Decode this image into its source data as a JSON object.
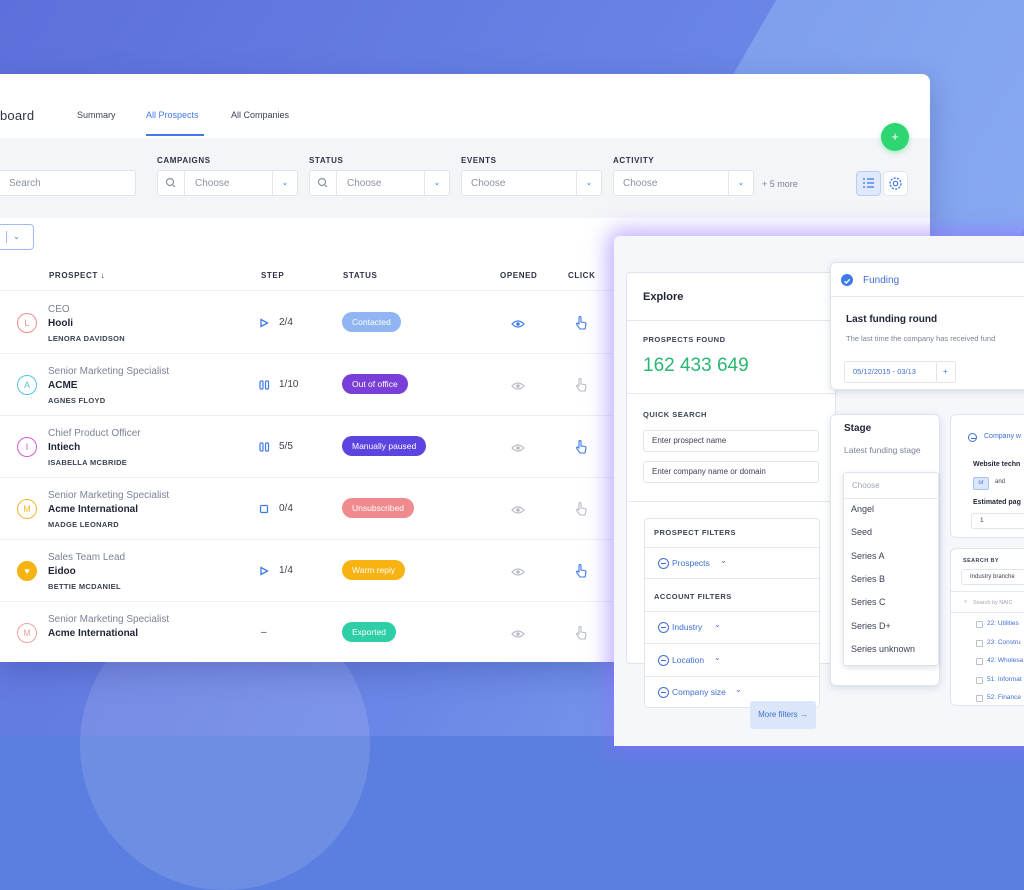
{
  "colors": {
    "accent": "#3f7be8",
    "green": "#2ed573",
    "found": "#2bb673"
  },
  "header": {
    "brand": "board",
    "tabs": [
      "Summary",
      "All Prospects",
      "All Companies"
    ],
    "add_label": "+"
  },
  "filters": {
    "search_placeholder": "Search",
    "campaigns_label": "CAMPAIGNS",
    "status_label": "STATUS",
    "events_label": "EVENTS",
    "activity_label": "ACTIVITY",
    "choose": "Choose",
    "more": "+ 5 more"
  },
  "table": {
    "headers": {
      "prospect": "PROSPECT ↓",
      "step": "STEP",
      "status": "STATUS",
      "opened": "OPENED",
      "click": "CLICK"
    },
    "rows": [
      {
        "initial": "L",
        "title": "CEO",
        "company": "Hooli",
        "name": "LENORA DAVIDSON",
        "step_icon": "play-icon",
        "step": "2/4",
        "status": "Contacted",
        "status_color": "#8fb5f3",
        "avatar_color": "#f08b8b",
        "opened": true,
        "clicked": true
      },
      {
        "initial": "A",
        "title": "Senior Marketing Specialist",
        "company": "ACME",
        "name": "AGNES FLOYD",
        "step_icon": "pause-icon",
        "step": "1/10",
        "status": "Out of office",
        "status_color": "#7a3fd6",
        "avatar_color": "#4fc7e0",
        "opened": false,
        "clicked": false
      },
      {
        "initial": "I",
        "title": "Chief Product Officer",
        "company": "Intiech",
        "name": "ISABELLA MCBRIDE",
        "step_icon": "pause-icon",
        "step": "5/5",
        "status": "Manually paused",
        "status_color": "#5b45e0",
        "avatar_color": "#d65bd6",
        "opened": false,
        "clicked": true
      },
      {
        "initial": "M",
        "title": "Senior Marketing Specialist",
        "company": "Acme International",
        "name": "MADGE LEONARD",
        "step_icon": "stop-icon",
        "step": "0/4",
        "status": "Unsubscribed",
        "status_color": "#f08a8e",
        "avatar_color": "#f2b731",
        "opened": false,
        "clicked": false
      },
      {
        "initial": "♥",
        "title": "Sales Team Lead",
        "company": "Eidoo",
        "name": "BETTIE MCDANIEL",
        "step_icon": "play-icon",
        "step": "1/4",
        "status": "Warm reply",
        "status_color": "#f7b312",
        "avatar_color": "#f7b312",
        "opened": false,
        "clicked": true
      },
      {
        "initial": "M",
        "title": "Senior Marketing Specialist",
        "company": "Acme International",
        "name": "",
        "step_icon": "",
        "step": "–",
        "status": "Exported",
        "status_color": "#2ecfa6",
        "avatar_color": "#f0a3a3",
        "opened": false,
        "clicked": false
      }
    ]
  },
  "explore": {
    "title": "Explore",
    "found_label": "PROSPECTS FOUND",
    "found_value": "162 433 649",
    "quick_label": "QUICK SEARCH",
    "prospect_ph": "Enter prospect name",
    "company_ph": "Enter company name or domain",
    "prospect_filters": "PROSPECT FILTERS",
    "prospects": "Prospects",
    "account_filters": "ACCOUNT FILTERS",
    "industry": "Industry",
    "location": "Location",
    "company_size": "Company size",
    "more_filters": "More filters →"
  },
  "funding": {
    "title": "Funding",
    "subtitle": "Last funding round",
    "desc": "The last time the company has received fund",
    "range": "05/12/2015 - 03/13",
    "plus": "+"
  },
  "stage": {
    "title": "Stage",
    "desc": "Latest funding stage",
    "choose": "Choose",
    "options": [
      "Angel",
      "Seed",
      "Series A",
      "Series B",
      "Series C",
      "Series D+",
      "Series unknown"
    ]
  },
  "company_card": {
    "label": "Company w",
    "tech_label": "Website techn",
    "or": "or",
    "and": "and",
    "est_label": "Estimated pag",
    "est_value": "1"
  },
  "search_card": {
    "label": "SEARCH BY",
    "select": "Industry branche",
    "search_ph": "Search by NAIC",
    "items": [
      "22: Utilities",
      "23: Constru",
      "42: Wholesa",
      "51: Informat",
      "52: Finance"
    ]
  }
}
